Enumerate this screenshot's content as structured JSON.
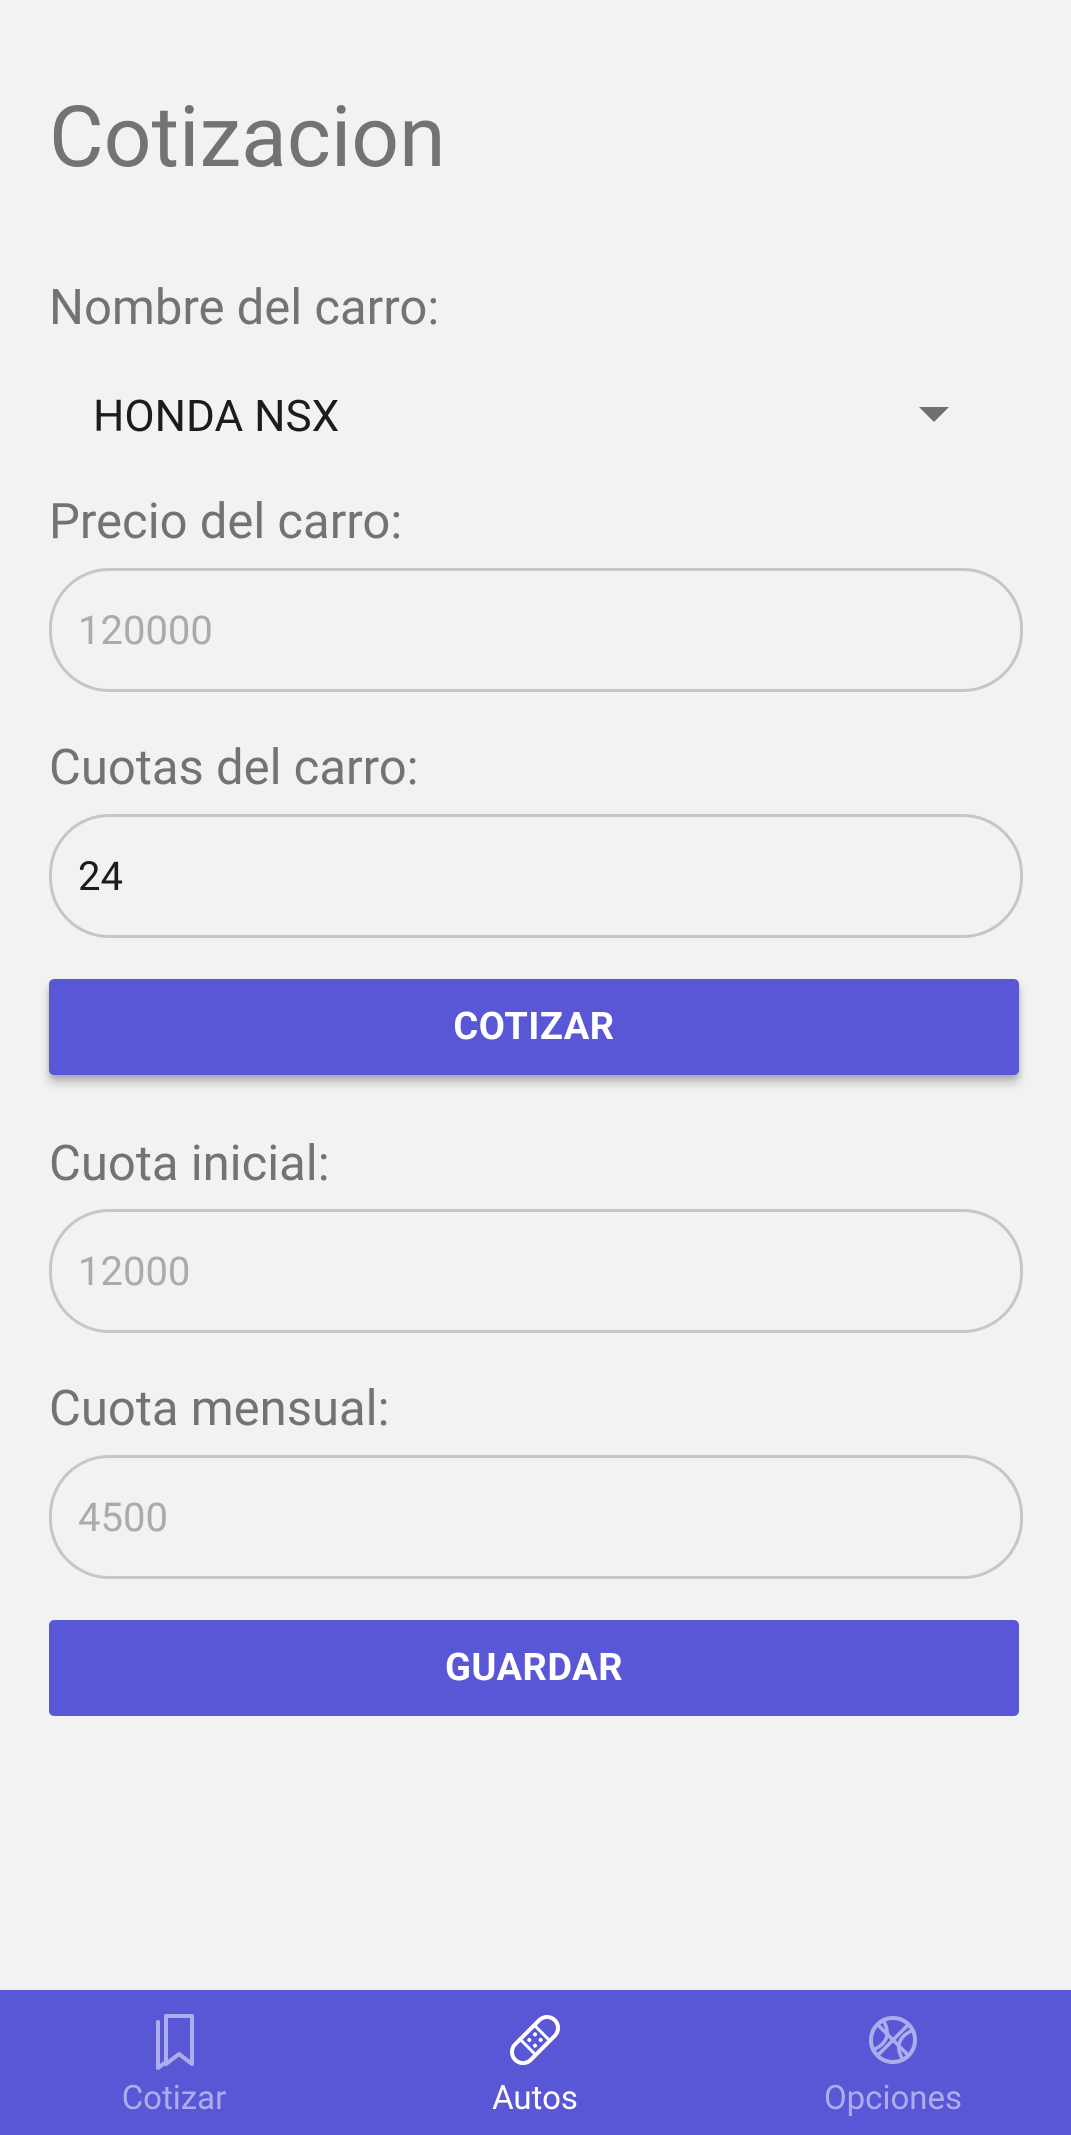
{
  "page": {
    "title": "Cotizacion"
  },
  "form": {
    "car_name_label": "Nombre del carro:",
    "car_name_selected": "HONDA NSX",
    "price_label": "Precio del carro:",
    "price_hint": "120000",
    "installments_label": "Cuotas del carro:",
    "installments_value": "24",
    "quote_button": "COTIZAR",
    "initial_payment_label": "Cuota inicial:",
    "initial_payment_hint": "12000",
    "monthly_payment_label": "Cuota mensual:",
    "monthly_payment_hint": "4500",
    "save_button": "GUARDAR"
  },
  "bottom_nav": {
    "items": [
      {
        "label": "Cotizar",
        "icon": "bookmarks-icon",
        "active": false
      },
      {
        "label": "Autos",
        "icon": "bandage-icon",
        "active": true
      },
      {
        "label": "Opciones",
        "icon": "basketball-icon",
        "active": false
      }
    ]
  },
  "colors": {
    "accent": "#5957d6",
    "background": "#f2f2f2",
    "label_text": "#737373",
    "hint_text": "#ababab",
    "nav_inactive": "#aeadec"
  }
}
